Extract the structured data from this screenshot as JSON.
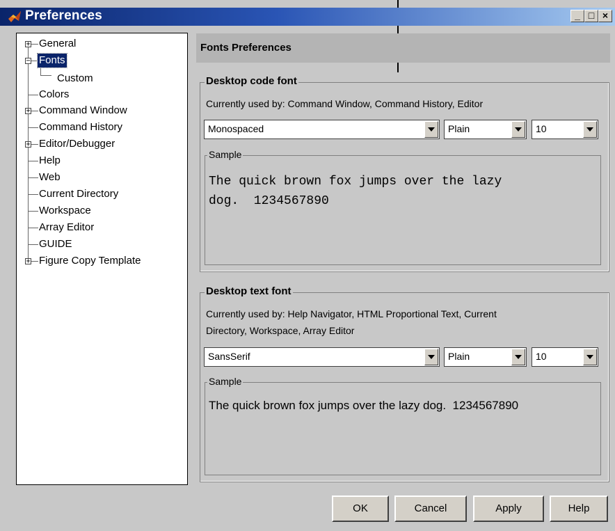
{
  "window": {
    "title": "Preferences",
    "title_icon": "matlab-logo-icon"
  },
  "titlebar_buttons": [
    "_",
    "□",
    "×"
  ],
  "tree": {
    "items": [
      {
        "label": "General",
        "expander": "+"
      },
      {
        "label": "Fonts",
        "expander": "−",
        "selected": true
      },
      {
        "label": "Custom"
      },
      {
        "label": "Colors"
      },
      {
        "label": "Command Window",
        "expander": "+"
      },
      {
        "label": "Command History"
      },
      {
        "label": "Editor/Debugger",
        "expander": "+"
      },
      {
        "label": "Help"
      },
      {
        "label": "Web"
      },
      {
        "label": "Current Directory"
      },
      {
        "label": "Workspace"
      },
      {
        "label": "Array Editor"
      },
      {
        "label": "GUIDE"
      },
      {
        "label": "Figure Copy Template",
        "expander": "+"
      }
    ]
  },
  "panel": {
    "header": "Fonts Preferences"
  },
  "code_font": {
    "title": "Desktop code font",
    "used_by": "Currently used by: Command Window, Command History, Editor",
    "family": "Monospaced",
    "style": "Plain",
    "size": "10",
    "sample_title": "Sample",
    "sample_line1": "The quick brown fox jumps over the lazy",
    "sample_line2": "dog.  1234567890"
  },
  "text_font": {
    "title": "Desktop text font",
    "used_by_line1": "Currently used by: Help Navigator, HTML Proportional Text, Current",
    "used_by_line2": "Directory, Workspace, Array Editor",
    "family": "SansSerif",
    "style": "Plain",
    "size": "10",
    "sample_title": "Sample",
    "sample_text": "The quick brown fox jumps over the lazy dog.  1234567890"
  },
  "buttons": {
    "ok": "OK",
    "cancel": "Cancel",
    "apply": "Apply",
    "help": "Help"
  },
  "colors": {
    "title_start": "#0a246a",
    "title_end": "#a6caf0",
    "panel_bg": "#c8c8c8",
    "header_bg": "#b4b4b4",
    "selection": "#0a246a"
  }
}
